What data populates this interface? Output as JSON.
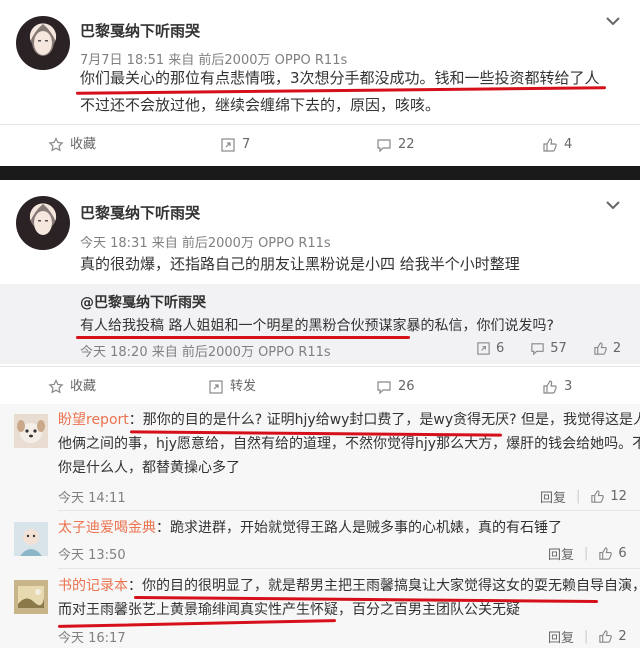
{
  "post1": {
    "username": "巴黎戛纳下听雨哭",
    "meta": "7月7日 18:51 来自 前后2000万 OPPO R11s",
    "text_line1_a": "你们最关心的那位有点悲情哦，",
    "text_line1_b": "3次想分手都没成功。钱和一些投资都转给了人",
    "text_line2": "不过还不会放过他，继续会缠绵下去的，原因，咳咳。",
    "actions": {
      "fav": "收藏",
      "repost": "7",
      "comment": "22",
      "like": "4"
    }
  },
  "post2": {
    "username": "巴黎戛纳下听雨哭",
    "meta": "今天 18:31 来自 前后2000万 OPPO R11s",
    "text": "真的很劲爆，还指路自己的朋友让黑粉说是小四  给我半个小时整理",
    "repost": {
      "user": "@巴黎戛纳下听雨哭",
      "text_underlined": "有人给我投稿 路人姐姐和一个明星的黑粉合伙预谋家暴的私信",
      "text_rest": "，你们说发吗?",
      "meta": "今天 18:20 来自 前后2000万 OPPO R11s",
      "repost_count": "6",
      "comment_count": "57",
      "like_count": "2"
    },
    "actions": {
      "fav": "收藏",
      "repost": "转发",
      "comment": "26",
      "like": "3"
    }
  },
  "comments": [
    {
      "user": "盼望report",
      "line1_a": "那你的目的是什么? 证明hjy给wy封口费了，是wy贪得无厌?",
      "line1_b": " 但是，我觉得这是人家",
      "line2": "他俩之间的事，hjy愿意给，自然有给的道理，不然你觉得hjy那么大方，爆肝的钱会给她吗。不管",
      "line3": "你是什么人，都替黄操心多了",
      "time": "今天 14:11",
      "reply": "回复",
      "likes": "12"
    },
    {
      "user": "太子迪爱喝金典",
      "text": "跪求进群，开始就觉得王路人是贼多事的心机婊，真的有石锤了",
      "time": "今天 13:50",
      "reply": "回复",
      "likes": "6"
    },
    {
      "user": "书的记录本",
      "line1_a": "你的目的很明显了，就是帮男主把王雨馨搞臭让大家觉得这女的耍无赖自导自演",
      "line1_b": "，从",
      "line2_a": "而对王雨馨张艺上黄景瑜绯闻真实性产生怀疑",
      "line2_b": "，百分之百男主团队公关无疑",
      "time": "今天 16:17",
      "reply": "回复",
      "likes": "2"
    }
  ],
  "colors": {
    "accent": "#eb7350",
    "underline": "#d6101a",
    "divider": "#1a1a1a"
  }
}
